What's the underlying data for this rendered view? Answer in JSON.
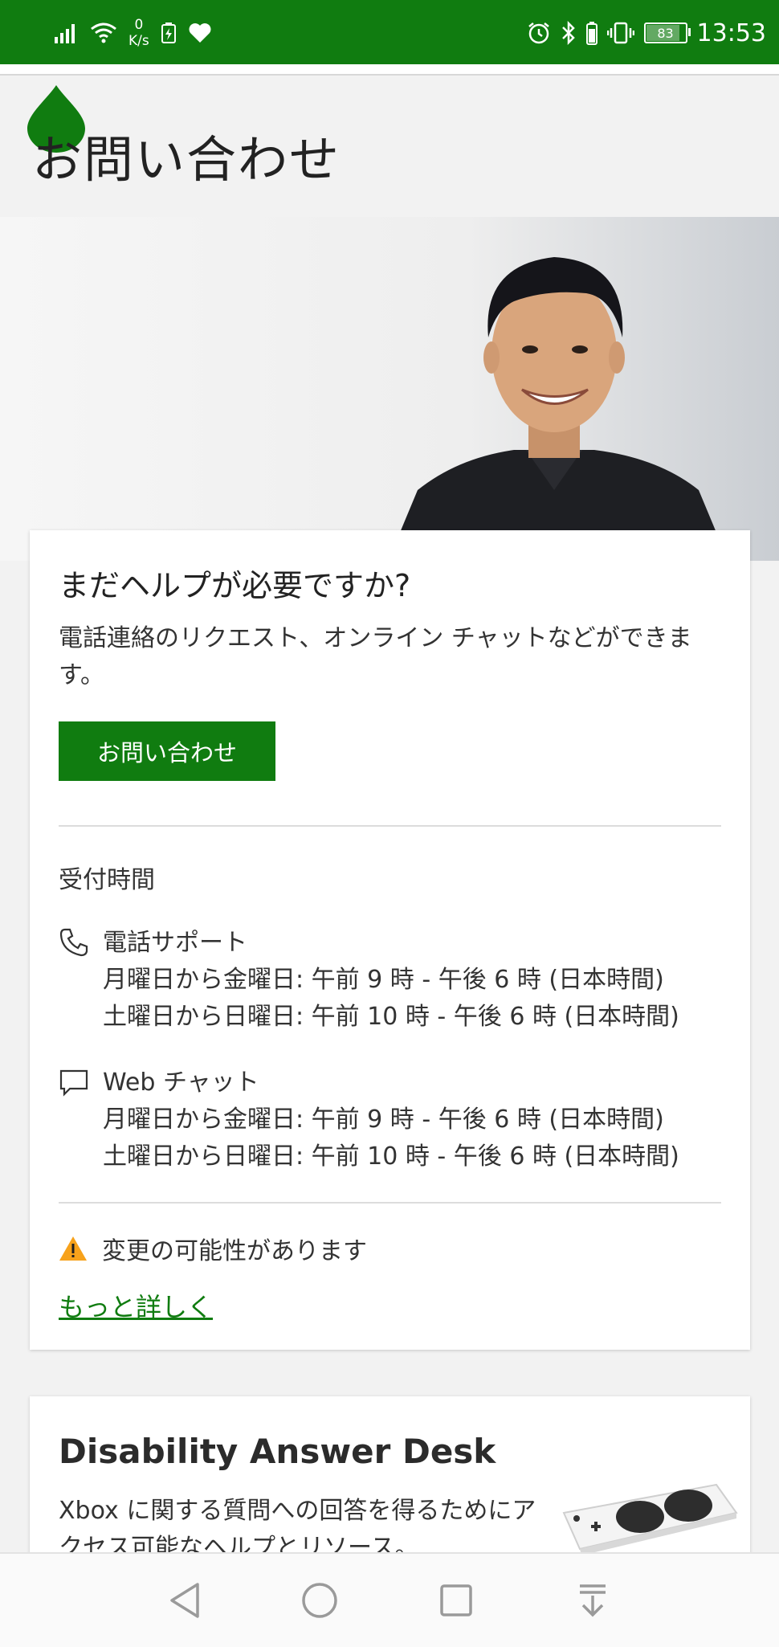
{
  "status_bar": {
    "net_speed_value": "0",
    "net_speed_unit": "K/s",
    "battery_percent": "83",
    "time": "13:53"
  },
  "header": {
    "title": "お問い合わせ"
  },
  "help_card": {
    "title": "まだヘルプが必要ですか?",
    "description": "電話連絡のリクエスト、オンライン チャットなどができます。",
    "contact_button": "お問い合わせ",
    "hours_title": "受付時間",
    "phone": {
      "name": "電話サポート",
      "lines": [
        "月曜日から金曜日: 午前 9 時 - 午後 6 時 (日本時間)",
        "土曜日から日曜日: 午前 10 時 - 午後 6 時 (日本時間)"
      ]
    },
    "chat": {
      "name": "Web チャット",
      "lines": [
        "月曜日から金曜日: 午前 9 時 - 午後 6 時 (日本時間)",
        "土曜日から日曜日: 午前 10 時 - 午後 6 時 (日本時間)"
      ]
    },
    "warning": "変更の可能性があります",
    "more_link": "もっと詳しく"
  },
  "disability_card": {
    "title": "Disability Answer Desk",
    "description": "Xbox に関する質問への回答を得るためにアクセス可能なヘルプとリソース。"
  },
  "colors": {
    "brand_green": "#107c10",
    "warning_orange": "#f7a21b"
  },
  "icons": [
    "signal-icon",
    "wifi-icon",
    "battery-saver-icon",
    "heart-icon",
    "alarm-icon",
    "bluetooth-icon",
    "vibrate-icon",
    "phone-icon",
    "chat-icon",
    "warning-icon",
    "back-icon",
    "home-icon",
    "recents-icon",
    "notifications-icon"
  ]
}
